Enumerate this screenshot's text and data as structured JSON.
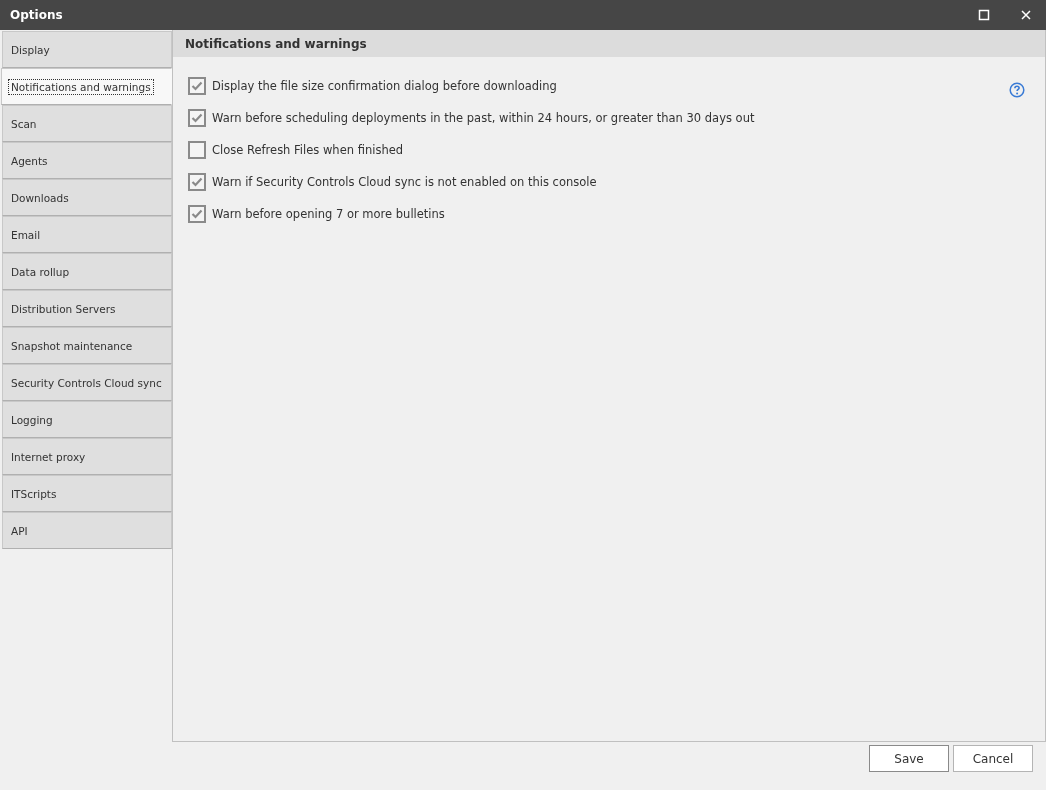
{
  "window": {
    "title": "Options"
  },
  "sidebar": {
    "items": [
      {
        "label": "Display",
        "selected": false
      },
      {
        "label": "Notifications and warnings",
        "selected": true
      },
      {
        "label": "Scan",
        "selected": false
      },
      {
        "label": "Agents",
        "selected": false
      },
      {
        "label": "Downloads",
        "selected": false
      },
      {
        "label": "Email",
        "selected": false
      },
      {
        "label": "Data rollup",
        "selected": false
      },
      {
        "label": "Distribution Servers",
        "selected": false
      },
      {
        "label": "Snapshot maintenance",
        "selected": false
      },
      {
        "label": "Security Controls Cloud sync",
        "selected": false
      },
      {
        "label": "Logging",
        "selected": false
      },
      {
        "label": "Internet proxy",
        "selected": false
      },
      {
        "label": "ITScripts",
        "selected": false
      },
      {
        "label": "API",
        "selected": false
      }
    ]
  },
  "panel": {
    "title": "Notifications and warnings",
    "options": [
      {
        "label": "Display the file size confirmation dialog before downloading",
        "checked": true
      },
      {
        "label": "Warn before scheduling deployments in the past, within 24 hours, or greater than 30 days out",
        "checked": true
      },
      {
        "label": "Close Refresh Files when finished",
        "checked": false
      },
      {
        "label": "Warn if Security Controls Cloud sync is not enabled on this console",
        "checked": true
      },
      {
        "label": "Warn before opening 7 or more bulletins",
        "checked": true
      }
    ]
  },
  "buttons": [
    "Save",
    "Cancel"
  ]
}
